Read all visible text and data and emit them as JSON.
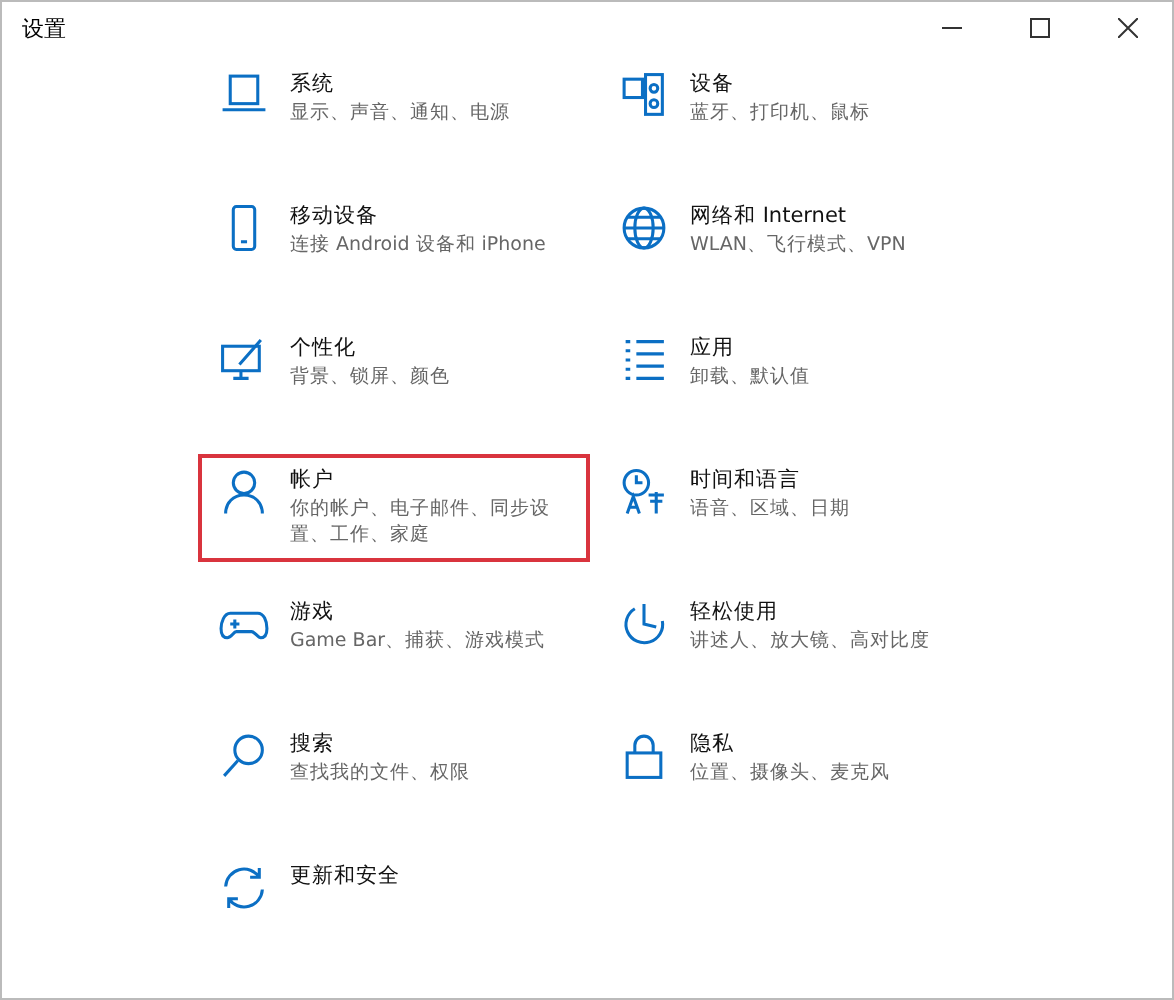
{
  "window": {
    "title": "设置"
  },
  "items": [
    {
      "title": "系统",
      "subtitle": "显示、声音、通知、电源",
      "selected": false
    },
    {
      "title": "设备",
      "subtitle": "蓝牙、打印机、鼠标",
      "selected": false
    },
    {
      "title": "移动设备",
      "subtitle": "连接 Android 设备和 iPhone",
      "selected": false
    },
    {
      "title": "网络和 Internet",
      "subtitle": "WLAN、飞行模式、VPN",
      "selected": false
    },
    {
      "title": "个性化",
      "subtitle": "背景、锁屏、颜色",
      "selected": false
    },
    {
      "title": "应用",
      "subtitle": "卸载、默认值",
      "selected": false
    },
    {
      "title": "帐户",
      "subtitle": "你的帐户、电子邮件、同步设置、工作、家庭",
      "selected": true
    },
    {
      "title": "时间和语言",
      "subtitle": "语音、区域、日期",
      "selected": false
    },
    {
      "title": "游戏",
      "subtitle": "Game Bar、捕获、游戏模式",
      "selected": false
    },
    {
      "title": "轻松使用",
      "subtitle": "讲述人、放大镜、高对比度",
      "selected": false
    },
    {
      "title": "搜索",
      "subtitle": "查找我的文件、权限",
      "selected": false
    },
    {
      "title": "隐私",
      "subtitle": "位置、摄像头、麦克风",
      "selected": false
    },
    {
      "title": "更新和安全",
      "selected": false
    }
  ]
}
